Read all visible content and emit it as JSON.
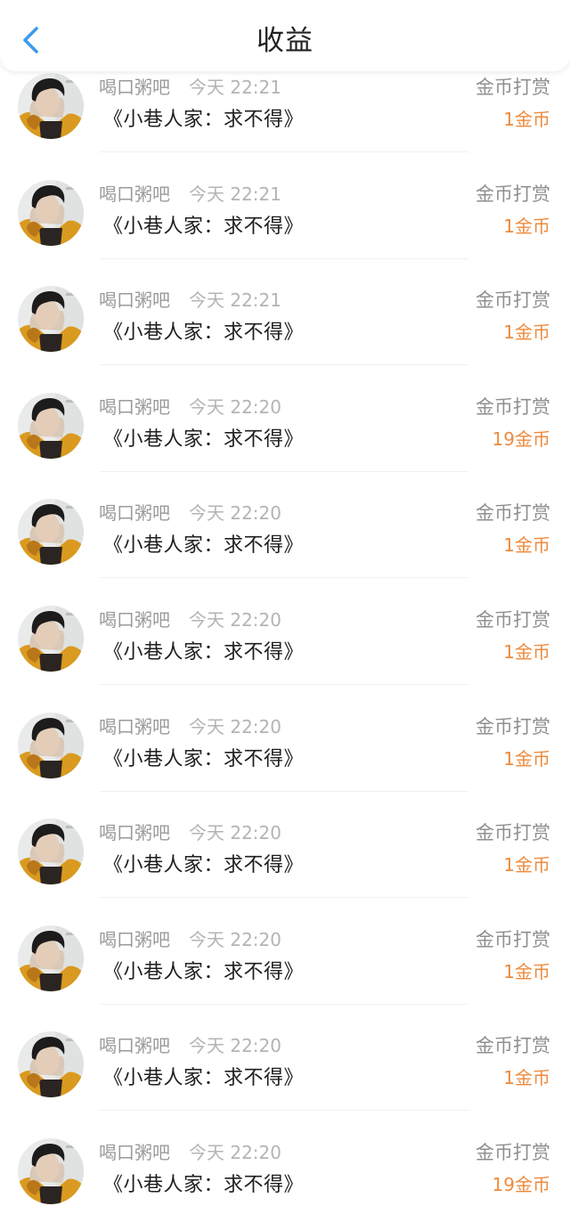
{
  "header": {
    "title": "收益"
  },
  "icons": {
    "back": "chevron-left-icon",
    "avatar": "user-avatar"
  },
  "colors": {
    "accent_back": "#3d9be9",
    "amount": "#ee8a3c",
    "username": "#9a9a9a",
    "time": "#b4b4b4",
    "type": "#8f8f8f",
    "book_title": "#1f1f1f"
  },
  "records": [
    {
      "user": "喝口粥吧",
      "time": "今天 22:21",
      "type": "金币打赏",
      "book": "《小巷人家：求不得》",
      "amount": "1金币"
    },
    {
      "user": "喝口粥吧",
      "time": "今天 22:21",
      "type": "金币打赏",
      "book": "《小巷人家：求不得》",
      "amount": "1金币"
    },
    {
      "user": "喝口粥吧",
      "time": "今天 22:21",
      "type": "金币打赏",
      "book": "《小巷人家：求不得》",
      "amount": "1金币"
    },
    {
      "user": "喝口粥吧",
      "time": "今天 22:20",
      "type": "金币打赏",
      "book": "《小巷人家：求不得》",
      "amount": "19金币"
    },
    {
      "user": "喝口粥吧",
      "time": "今天 22:20",
      "type": "金币打赏",
      "book": "《小巷人家：求不得》",
      "amount": "1金币"
    },
    {
      "user": "喝口粥吧",
      "time": "今天 22:20",
      "type": "金币打赏",
      "book": "《小巷人家：求不得》",
      "amount": "1金币"
    },
    {
      "user": "喝口粥吧",
      "time": "今天 22:20",
      "type": "金币打赏",
      "book": "《小巷人家：求不得》",
      "amount": "1金币"
    },
    {
      "user": "喝口粥吧",
      "time": "今天 22:20",
      "type": "金币打赏",
      "book": "《小巷人家：求不得》",
      "amount": "1金币"
    },
    {
      "user": "喝口粥吧",
      "time": "今天 22:20",
      "type": "金币打赏",
      "book": "《小巷人家：求不得》",
      "amount": "1金币"
    },
    {
      "user": "喝口粥吧",
      "time": "今天 22:20",
      "type": "金币打赏",
      "book": "《小巷人家：求不得》",
      "amount": "1金币"
    },
    {
      "user": "喝口粥吧",
      "time": "今天 22:20",
      "type": "金币打赏",
      "book": "《小巷人家：求不得》",
      "amount": "19金币"
    }
  ]
}
